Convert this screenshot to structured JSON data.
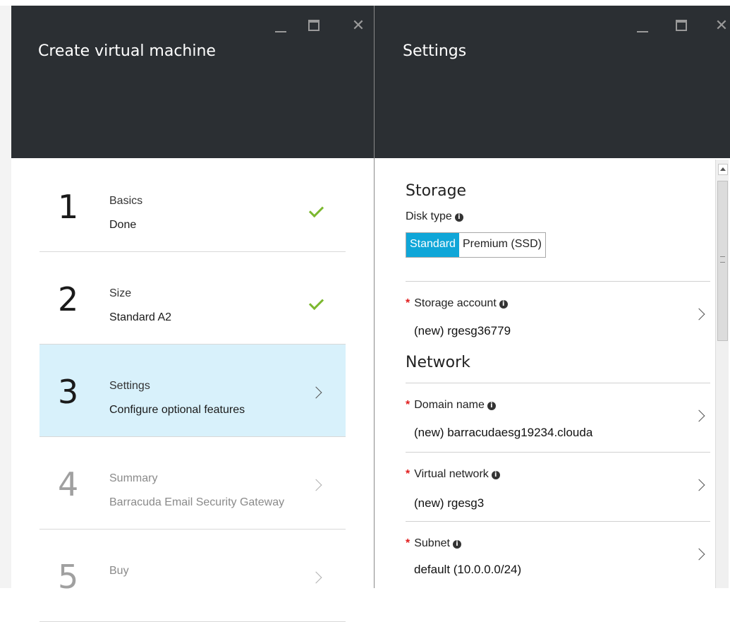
{
  "left_blade": {
    "title": "Create virtual machine",
    "controls": {
      "minimize": "_",
      "close": "✕"
    },
    "steps": [
      {
        "number": "1",
        "title": "Basics",
        "subtitle": "Done",
        "status": "done"
      },
      {
        "number": "2",
        "title": "Size",
        "subtitle": "Standard A2",
        "status": "done"
      },
      {
        "number": "3",
        "title": "Settings",
        "subtitle": "Configure optional features",
        "status": "active"
      },
      {
        "number": "4",
        "title": "Summary",
        "subtitle": "Barracuda Email Security Gateway",
        "status": "disabled"
      },
      {
        "number": "5",
        "title": "Buy",
        "subtitle": "",
        "status": "disabled"
      }
    ]
  },
  "right_blade": {
    "title": "Settings",
    "controls": {
      "minimize": "_",
      "close": "✕"
    },
    "storage": {
      "title": "Storage",
      "disk_type_label": "Disk type",
      "disk_type_options": [
        "Standard",
        "Premium (SSD)"
      ],
      "disk_type_selected": "Standard",
      "storage_account": {
        "label": "Storage account",
        "required": "*",
        "value": "(new) rgesg36779"
      }
    },
    "network": {
      "title": "Network",
      "domain_name": {
        "label": "Domain name",
        "required": "*",
        "value": "(new) barracudaesg19234.clouda"
      },
      "virtual_network": {
        "label": "Virtual network",
        "required": "*",
        "value": "(new) rgesg3"
      },
      "subnet": {
        "label": "Subnet",
        "required": "*",
        "value": "default (10.0.0.0/24)"
      }
    },
    "info_icon": "i"
  },
  "colors": {
    "header_bg": "#2b2f33",
    "active_step_bg": "#d8f1fb",
    "selected_toggle": "#0fa6d8",
    "check": "#7cb82f",
    "required": "#e11c1c"
  }
}
